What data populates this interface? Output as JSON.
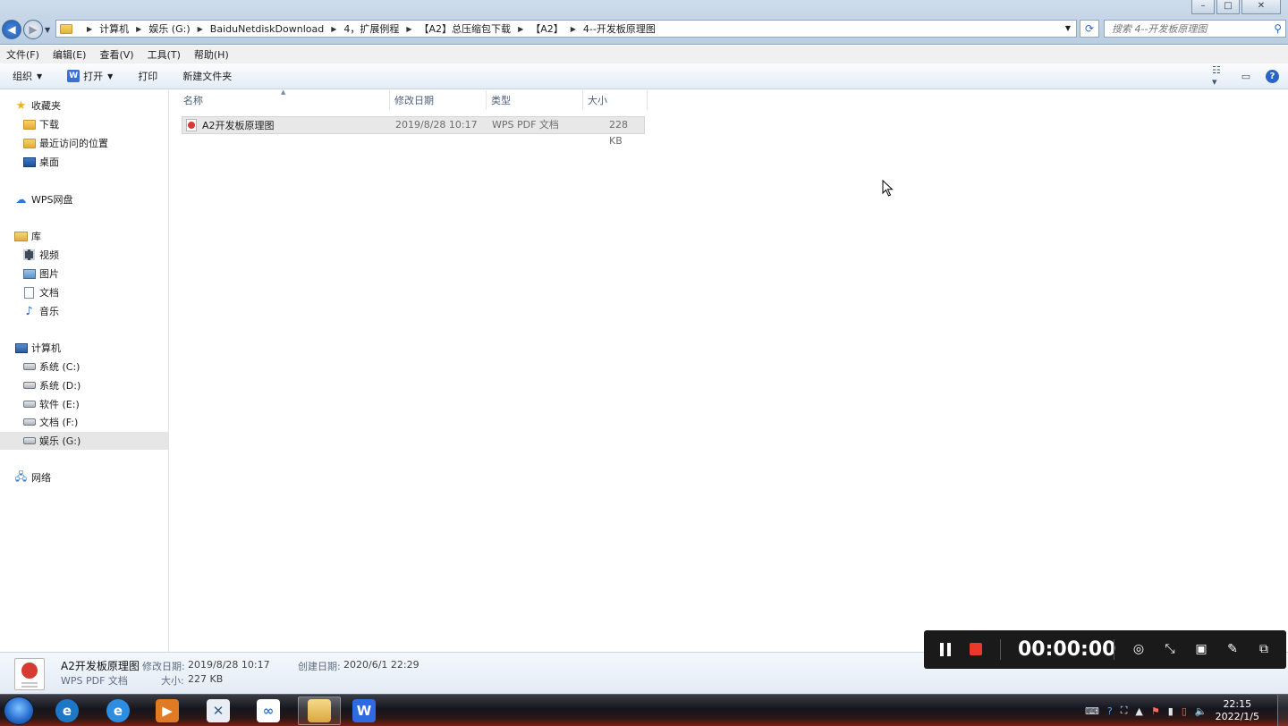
{
  "window": {
    "controls": {
      "minimize": "–",
      "maximize": "□",
      "close": "✕"
    },
    "address": {
      "crumbs": [
        "计算机",
        "娱乐 (G:)",
        "BaiduNetdiskDownload",
        "4，扩展例程",
        "【A2】总压缩包下载",
        "【A2】",
        "4--开发板原理图"
      ]
    },
    "search": {
      "placeholder": "搜索 4--开发板原理图"
    }
  },
  "menubar": [
    "文件(F)",
    "编辑(E)",
    "查看(V)",
    "工具(T)",
    "帮助(H)"
  ],
  "toolbar": {
    "organize": "组织",
    "open": "打开",
    "print": "打印",
    "new_folder": "新建文件夹"
  },
  "navpane": {
    "favorites": {
      "title": "收藏夹",
      "items": [
        "下载",
        "最近访问的位置",
        "桌面"
      ]
    },
    "wps": "WPS网盘",
    "libraries": {
      "title": "库",
      "items": [
        "视频",
        "图片",
        "文档",
        "音乐"
      ]
    },
    "computer": {
      "title": "计算机",
      "items": [
        "系统 (C:)",
        "系统 (D:)",
        "软件 (E:)",
        "文档 (F:)",
        "娱乐 (G:)"
      ]
    },
    "network": "网络"
  },
  "columns": [
    "名称",
    "修改日期",
    "类型",
    "大小"
  ],
  "files": [
    {
      "name": "A2开发板原理图",
      "modified": "2019/8/28 10:17",
      "type": "WPS PDF 文档",
      "size": "228 KB"
    }
  ],
  "details": {
    "name": "A2开发板原理图",
    "type": "WPS PDF 文档",
    "modified_label": "修改日期:",
    "modified": "2019/8/28 10:17",
    "created_label": "创建日期:",
    "created": "2020/6/1 22:29",
    "size_label": "大小:",
    "size": "227 KB"
  },
  "recorder": {
    "time": "00:00:00"
  },
  "taskbar": {
    "clock_time": "22:15",
    "clock_date": "2022/1/5"
  },
  "colors": {
    "accent": "#2c64c4",
    "recorder_bg": "#1a1a1a",
    "stop": "#e8392b"
  }
}
